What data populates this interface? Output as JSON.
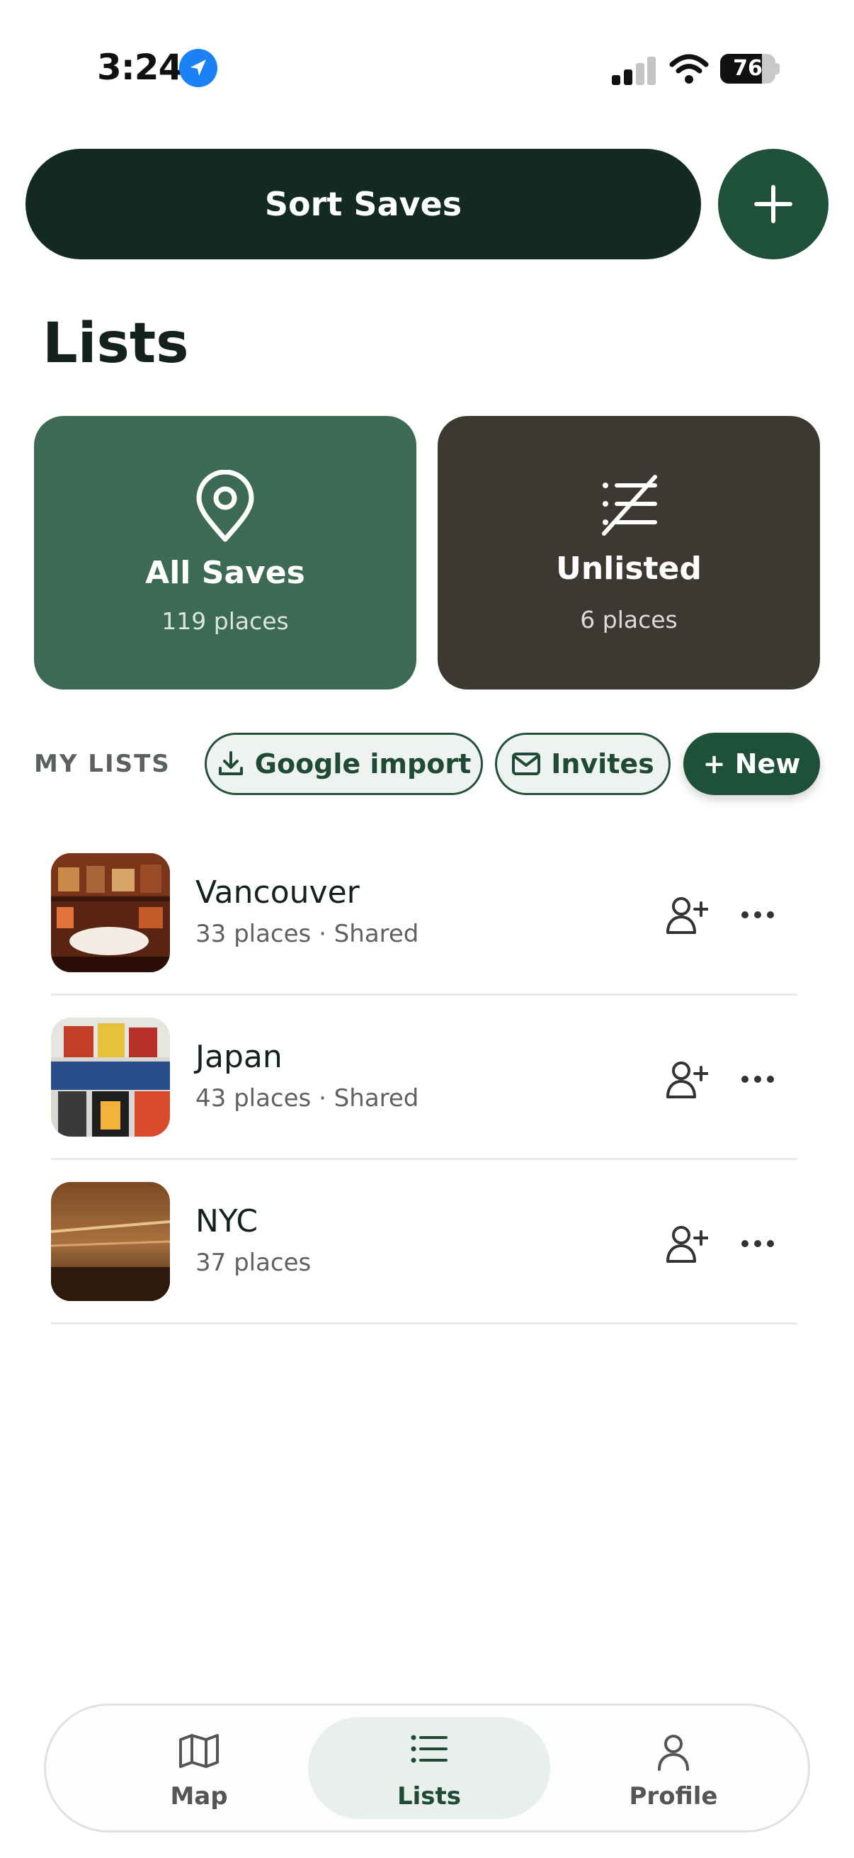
{
  "status": {
    "time": "3:24",
    "battery": "76"
  },
  "header": {
    "sort_label": "Sort Saves",
    "add_icon": "plus-icon"
  },
  "page_title": "Lists",
  "cards": {
    "all": {
      "title": "All Saves",
      "subtitle": "119 places",
      "color": "#3c6a55",
      "icon": "map-pin-icon"
    },
    "unlisted": {
      "title": "Unlisted",
      "subtitle": "6 places",
      "color": "#3e3832",
      "icon": "unlisted-icon"
    }
  },
  "my_lists": {
    "heading": "MY LISTS",
    "google_import": "Google import",
    "invites": "Invites",
    "new": "+ New"
  },
  "lists": [
    {
      "name": "Vancouver",
      "subtitle": "33 places · Shared"
    },
    {
      "name": "Japan",
      "subtitle": "43 places · Shared"
    },
    {
      "name": "NYC",
      "subtitle": "37 places"
    }
  ],
  "nav": [
    {
      "label": "Map",
      "icon": "map-icon",
      "active": false
    },
    {
      "label": "Lists",
      "icon": "list-icon",
      "active": true
    },
    {
      "label": "Profile",
      "icon": "person-icon",
      "active": false
    }
  ],
  "colors": {
    "accent": "#1f5039",
    "dark": "#122a21"
  }
}
